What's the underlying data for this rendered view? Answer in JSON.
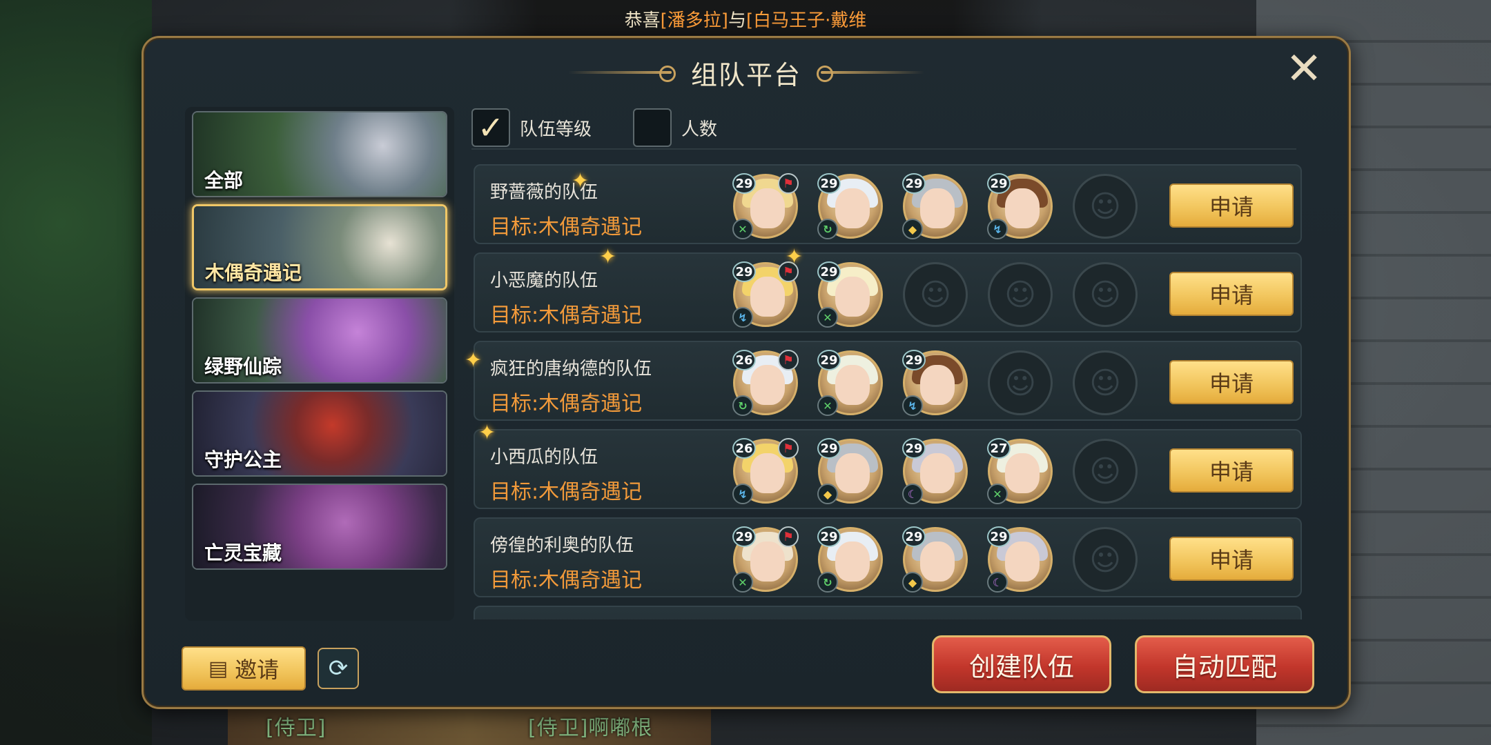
{
  "broadcast": {
    "prefix": "恭喜",
    "name1": "[潘多拉]",
    "mid": "与",
    "name2": "[白马王子·戴维"
  },
  "dialog": {
    "title": "组队平台",
    "close_icon": "close-x-icon"
  },
  "categories": [
    {
      "label": "全部",
      "active": false
    },
    {
      "label": "木偶奇遇记",
      "active": true
    },
    {
      "label": "绿野仙踪",
      "active": false
    },
    {
      "label": "守护公主",
      "active": false
    },
    {
      "label": "亡灵宝藏",
      "active": false
    }
  ],
  "filters": [
    {
      "label": "队伍等级",
      "checked": true
    },
    {
      "label": "人数",
      "checked": false
    }
  ],
  "teams": [
    {
      "name": "野蔷薇的队伍",
      "goal": "目标:木偶奇遇记",
      "apply": "申请",
      "members": [
        {
          "level": "29"
        },
        {
          "level": "29"
        },
        {
          "level": "29"
        },
        {
          "level": "29"
        }
      ]
    },
    {
      "name": "小恶魔的队伍",
      "goal": "目标:木偶奇遇记",
      "apply": "申请",
      "members": [
        {
          "level": "29"
        },
        {
          "level": "29"
        }
      ]
    },
    {
      "name": "疯狂的唐纳德的队伍",
      "goal": "目标:木偶奇遇记",
      "apply": "申请",
      "members": [
        {
          "level": "26"
        },
        {
          "level": "29"
        },
        {
          "level": "29"
        }
      ]
    },
    {
      "name": "小西瓜的队伍",
      "goal": "目标:木偶奇遇记",
      "apply": "申请",
      "members": [
        {
          "level": "26"
        },
        {
          "level": "29"
        },
        {
          "level": "29"
        },
        {
          "level": "27"
        }
      ]
    },
    {
      "name": "傍徨的利奥的队伍",
      "goal": "目标:木偶奇遇记",
      "apply": "申请",
      "members": [
        {
          "level": "29"
        },
        {
          "level": "29"
        },
        {
          "level": "29"
        },
        {
          "level": "29"
        }
      ]
    }
  ],
  "bottom": {
    "invite": "邀请",
    "create_team": "创建队伍",
    "auto_match": "自动匹配",
    "names": [
      "[侍卫]",
      "[侍卫]啊嘟根"
    ]
  },
  "colors": {
    "accent_gold": "#f2c65e",
    "goal_orange": "#f29a3a",
    "red_button": "#c2362b"
  }
}
